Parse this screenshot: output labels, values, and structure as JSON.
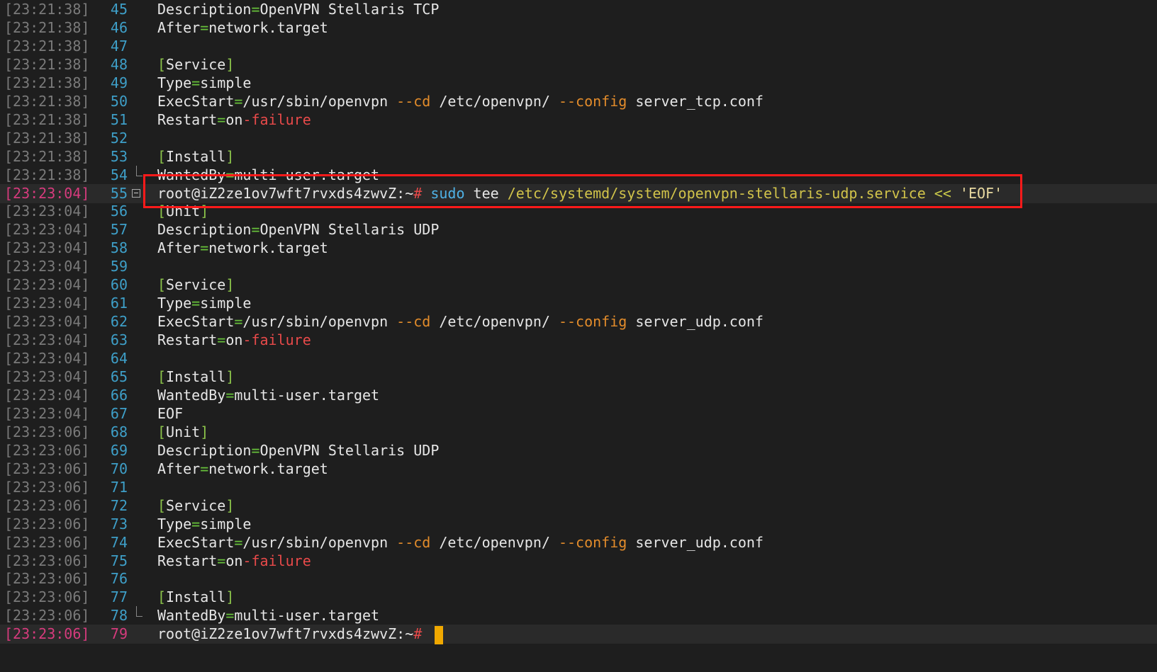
{
  "accent_colors": {
    "background": "#1e1e1e",
    "timestamp": "#7a7a7a",
    "line_number": "#3e9fc8",
    "highlight_box": "#ff1a1a",
    "cursor": "#f0a800"
  },
  "lines": [
    {
      "ts": "[23:21:38]",
      "n": "45",
      "segments": [
        [
          "key",
          "Description"
        ],
        [
          "eq",
          "="
        ],
        [
          "val",
          "OpenVPN Stellaris TCP"
        ]
      ]
    },
    {
      "ts": "[23:21:38]",
      "n": "46",
      "segments": [
        [
          "key",
          "After"
        ],
        [
          "eq",
          "="
        ],
        [
          "val",
          "network.target"
        ]
      ]
    },
    {
      "ts": "[23:21:38]",
      "n": "47",
      "segments": []
    },
    {
      "ts": "[23:21:38]",
      "n": "48",
      "segments": [
        [
          "br",
          "["
        ],
        [
          "key",
          "Service"
        ],
        [
          "br",
          "]"
        ]
      ]
    },
    {
      "ts": "[23:21:38]",
      "n": "49",
      "segments": [
        [
          "key",
          "Type"
        ],
        [
          "eq",
          "="
        ],
        [
          "val",
          "simple"
        ]
      ]
    },
    {
      "ts": "[23:21:38]",
      "n": "50",
      "segments": [
        [
          "key",
          "ExecStart"
        ],
        [
          "eq",
          "="
        ],
        [
          "val",
          "/usr/sbin/openvpn "
        ],
        [
          "flag",
          "--cd"
        ],
        [
          "val",
          " /etc/openvpn/ "
        ],
        [
          "flag",
          "--config"
        ],
        [
          "val",
          " server_tcp.conf"
        ]
      ]
    },
    {
      "ts": "[23:21:38]",
      "n": "51",
      "segments": [
        [
          "key",
          "Restart"
        ],
        [
          "eq",
          "="
        ],
        [
          "val",
          "on"
        ],
        [
          "fail",
          "-failure"
        ]
      ]
    },
    {
      "ts": "[23:21:38]",
      "n": "52",
      "segments": []
    },
    {
      "ts": "[23:21:38]",
      "n": "53",
      "segments": [
        [
          "br",
          "["
        ],
        [
          "key",
          "Install"
        ],
        [
          "br",
          "]"
        ]
      ]
    },
    {
      "ts": "[23:21:38]",
      "n": "54",
      "fold": "end",
      "segments": [
        [
          "key",
          "WantedBy"
        ],
        [
          "eq",
          "="
        ],
        [
          "val",
          "multi-user.target"
        ]
      ]
    },
    {
      "ts": "[23:23:04]",
      "n": "55",
      "fold": "box",
      "current": true,
      "segments": [
        [
          "val",
          "root@iZ2ze1ov7wft7rvxds4zwvZ:~"
        ],
        [
          "hash",
          "#"
        ],
        [
          "val",
          " "
        ],
        [
          "cmd",
          "sudo"
        ],
        [
          "val",
          " tee "
        ],
        [
          "path",
          "/etc/systemd/system/openvpn-stellaris-udp.service"
        ],
        [
          "val",
          " "
        ],
        [
          "op",
          "<<"
        ],
        [
          "val",
          " "
        ],
        [
          "str",
          "'EOF'"
        ]
      ]
    },
    {
      "ts": "[23:23:04]",
      "n": "56",
      "segments": [
        [
          "br",
          "["
        ],
        [
          "key",
          "Unit"
        ],
        [
          "br",
          "]"
        ]
      ]
    },
    {
      "ts": "[23:23:04]",
      "n": "57",
      "segments": [
        [
          "key",
          "Description"
        ],
        [
          "eq",
          "="
        ],
        [
          "val",
          "OpenVPN Stellaris UDP"
        ]
      ]
    },
    {
      "ts": "[23:23:04]",
      "n": "58",
      "segments": [
        [
          "key",
          "After"
        ],
        [
          "eq",
          "="
        ],
        [
          "val",
          "network.target"
        ]
      ]
    },
    {
      "ts": "[23:23:04]",
      "n": "59",
      "segments": []
    },
    {
      "ts": "[23:23:04]",
      "n": "60",
      "segments": [
        [
          "br",
          "["
        ],
        [
          "key",
          "Service"
        ],
        [
          "br",
          "]"
        ]
      ]
    },
    {
      "ts": "[23:23:04]",
      "n": "61",
      "segments": [
        [
          "key",
          "Type"
        ],
        [
          "eq",
          "="
        ],
        [
          "val",
          "simple"
        ]
      ]
    },
    {
      "ts": "[23:23:04]",
      "n": "62",
      "segments": [
        [
          "key",
          "ExecStart"
        ],
        [
          "eq",
          "="
        ],
        [
          "val",
          "/usr/sbin/openvpn "
        ],
        [
          "flag",
          "--cd"
        ],
        [
          "val",
          " /etc/openvpn/ "
        ],
        [
          "flag",
          "--config"
        ],
        [
          "val",
          " server_udp.conf"
        ]
      ]
    },
    {
      "ts": "[23:23:04]",
      "n": "63",
      "segments": [
        [
          "key",
          "Restart"
        ],
        [
          "eq",
          "="
        ],
        [
          "val",
          "on"
        ],
        [
          "fail",
          "-failure"
        ]
      ]
    },
    {
      "ts": "[23:23:04]",
      "n": "64",
      "segments": []
    },
    {
      "ts": "[23:23:04]",
      "n": "65",
      "segments": [
        [
          "br",
          "["
        ],
        [
          "key",
          "Install"
        ],
        [
          "br",
          "]"
        ]
      ]
    },
    {
      "ts": "[23:23:04]",
      "n": "66",
      "segments": [
        [
          "key",
          "WantedBy"
        ],
        [
          "eq",
          "="
        ],
        [
          "val",
          "multi-user.target"
        ]
      ]
    },
    {
      "ts": "[23:23:04]",
      "n": "67",
      "segments": [
        [
          "val",
          "EOF"
        ]
      ]
    },
    {
      "ts": "[23:23:06]",
      "n": "68",
      "segments": [
        [
          "br",
          "["
        ],
        [
          "key",
          "Unit"
        ],
        [
          "br",
          "]"
        ]
      ]
    },
    {
      "ts": "[23:23:06]",
      "n": "69",
      "segments": [
        [
          "key",
          "Description"
        ],
        [
          "eq",
          "="
        ],
        [
          "val",
          "OpenVPN Stellaris UDP"
        ]
      ]
    },
    {
      "ts": "[23:23:06]",
      "n": "70",
      "segments": [
        [
          "key",
          "After"
        ],
        [
          "eq",
          "="
        ],
        [
          "val",
          "network.target"
        ]
      ]
    },
    {
      "ts": "[23:23:06]",
      "n": "71",
      "segments": []
    },
    {
      "ts": "[23:23:06]",
      "n": "72",
      "segments": [
        [
          "br",
          "["
        ],
        [
          "key",
          "Service"
        ],
        [
          "br",
          "]"
        ]
      ]
    },
    {
      "ts": "[23:23:06]",
      "n": "73",
      "segments": [
        [
          "key",
          "Type"
        ],
        [
          "eq",
          "="
        ],
        [
          "val",
          "simple"
        ]
      ]
    },
    {
      "ts": "[23:23:06]",
      "n": "74",
      "segments": [
        [
          "key",
          "ExecStart"
        ],
        [
          "eq",
          "="
        ],
        [
          "val",
          "/usr/sbin/openvpn "
        ],
        [
          "flag",
          "--cd"
        ],
        [
          "val",
          " /etc/openvpn/ "
        ],
        [
          "flag",
          "--config"
        ],
        [
          "val",
          " server_udp.conf"
        ]
      ]
    },
    {
      "ts": "[23:23:06]",
      "n": "75",
      "segments": [
        [
          "key",
          "Restart"
        ],
        [
          "eq",
          "="
        ],
        [
          "val",
          "on"
        ],
        [
          "fail",
          "-failure"
        ]
      ]
    },
    {
      "ts": "[23:23:06]",
      "n": "76",
      "segments": []
    },
    {
      "ts": "[23:23:06]",
      "n": "77",
      "segments": [
        [
          "br",
          "["
        ],
        [
          "key",
          "Install"
        ],
        [
          "br",
          "]"
        ]
      ]
    },
    {
      "ts": "[23:23:06]",
      "n": "78",
      "fold": "end",
      "segments": [
        [
          "key",
          "WantedBy"
        ],
        [
          "eq",
          "="
        ],
        [
          "val",
          "multi-user.target"
        ]
      ]
    },
    {
      "ts": "[23:23:06]",
      "n": "79",
      "last": true,
      "cursor": true,
      "segments": [
        [
          "val",
          "root@iZ2ze1ov7wft7rvxds4zwvZ:~"
        ],
        [
          "hash",
          "#"
        ],
        [
          "val",
          " "
        ]
      ]
    }
  ]
}
